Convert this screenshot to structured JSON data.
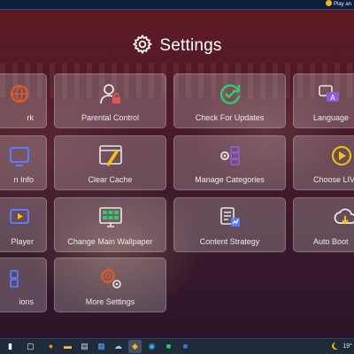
{
  "window": {
    "title": "Play an",
    "accent": "#0b1f3d"
  },
  "header": {
    "title": "Settings",
    "icon": "gear-icon"
  },
  "tiles": [
    {
      "label": "rk",
      "icon": "network-icon",
      "color": "#e05a2b"
    },
    {
      "label": "Parental Control",
      "icon": "parental-control-icon",
      "color": "#e8e8e8"
    },
    {
      "label": "Check For Updates",
      "icon": "check-updates-icon",
      "color": "#2ecc71"
    },
    {
      "label": "Language",
      "icon": "language-icon",
      "color": "#e8e8e8"
    },
    {
      "label": "n Info",
      "icon": "info-icon",
      "color": "#5b7cff"
    },
    {
      "label": "Clear Cache",
      "icon": "clear-cache-icon",
      "color": "#f1c40f"
    },
    {
      "label": "Manage Categories",
      "icon": "manage-categories-icon",
      "color": "#8e5cd9"
    },
    {
      "label": "Choose LIV",
      "icon": "play-circle-icon",
      "color": "#f1c40f"
    },
    {
      "label": "Player",
      "icon": "player-icon",
      "color": "#5b7cff"
    },
    {
      "label": "Change Main Wallpaper",
      "icon": "wallpaper-icon",
      "color": "#2ecc71"
    },
    {
      "label": "Content Strategy",
      "icon": "content-strategy-icon",
      "color": "#e8e8e8"
    },
    {
      "label": "Auto Boot",
      "icon": "auto-boot-icon",
      "color": "#f1c40f"
    },
    {
      "label": "ions",
      "icon": "extensions-icon",
      "color": "#5b7cff"
    },
    {
      "label": "More Settings",
      "icon": "more-settings-icon",
      "color": "#e05a2b"
    }
  ],
  "taskbar": {
    "items": [
      {
        "name": "start-icon",
        "glyph": "▮"
      },
      {
        "name": "task-view-icon",
        "glyph": "▢"
      },
      {
        "name": "firefox-icon",
        "glyph": "●",
        "color": "#ff8a1f"
      },
      {
        "name": "file-explorer-icon",
        "glyph": "▬",
        "color": "#f6c343"
      },
      {
        "name": "notepad-icon",
        "glyph": "▤",
        "color": "#d8dde6"
      },
      {
        "name": "store-icon",
        "glyph": "▦",
        "color": "#4aa3ff"
      },
      {
        "name": "weather-icon",
        "glyph": "☁",
        "color": "#8fd0ff"
      },
      {
        "name": "emulator-icon",
        "glyph": "◆",
        "color": "#f1b62a",
        "active": true
      },
      {
        "name": "edge-icon",
        "glyph": "◉",
        "color": "#3bb5f5"
      },
      {
        "name": "app-green-icon",
        "glyph": "■",
        "color": "#2ecc71"
      },
      {
        "name": "app-blue-icon",
        "glyph": "■",
        "color": "#3a7bd5"
      }
    ],
    "temperature": "19°",
    "tray_icon": "moon-icon"
  }
}
